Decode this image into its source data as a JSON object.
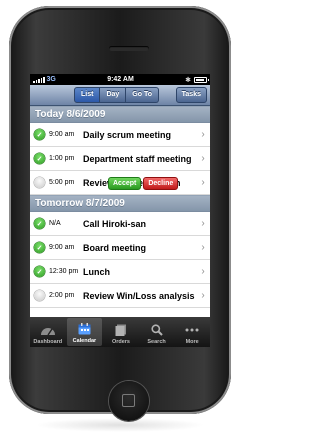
{
  "status_bar": {
    "carrier": "3G",
    "time": "9:42 AM"
  },
  "nav": {
    "segments": [
      "List",
      "Day",
      "Go To"
    ],
    "selected": "List",
    "tasks_label": "Tasks"
  },
  "sections": [
    {
      "title": "Today 8/6/2009",
      "events": [
        {
          "time": "9:00 am",
          "title": "Daily scrum meeting",
          "accepted": true
        },
        {
          "time": "1:00 pm",
          "title": "Department staff meeting",
          "accepted": true
        },
        {
          "time": "5:00 pm",
          "title": "Review marketing plan",
          "accepted": false
        }
      ]
    },
    {
      "title": "Tomorrow 8/7/2009",
      "events": [
        {
          "time": "N/A",
          "title": "Call Hiroki-san",
          "accepted": true
        },
        {
          "time": "9:00 am",
          "title": "Board meeting",
          "accepted": true
        },
        {
          "time": "12:30 pm",
          "title": "Lunch",
          "accepted": true
        },
        {
          "time": "2:00 pm",
          "title": "Review Win/Loss analysis",
          "accepted": false
        }
      ]
    }
  ],
  "invite_actions": {
    "accept": "Accept",
    "decline": "Decline"
  },
  "tabbar": {
    "items": [
      {
        "label": "Dashboard",
        "icon": "dashboard-icon"
      },
      {
        "label": "Calendar",
        "icon": "calendar-icon"
      },
      {
        "label": "Orders",
        "icon": "orders-icon"
      },
      {
        "label": "Search",
        "icon": "search-icon"
      },
      {
        "label": "More",
        "icon": "more-icon"
      }
    ],
    "selected": "Calendar"
  },
  "colors": {
    "accept": "#2a9a21",
    "decline": "#c11a1a",
    "nav_blue": "#4c6690"
  }
}
